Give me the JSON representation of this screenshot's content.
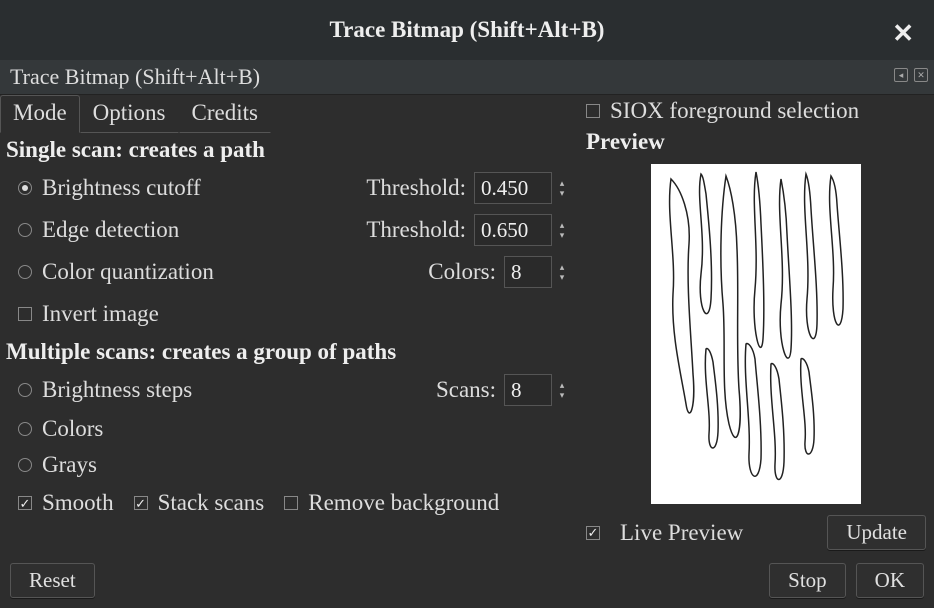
{
  "window": {
    "title": "Trace Bitmap (Shift+Alt+B)",
    "subtitle": "Trace Bitmap (Shift+Alt+B)"
  },
  "tabs": {
    "mode": "Mode",
    "options": "Options",
    "credits": "Credits"
  },
  "single_scan": {
    "title": "Single scan: creates a path",
    "brightness": "Brightness cutoff",
    "brightness_threshold_label": "Threshold:",
    "brightness_threshold_value": "0.450",
    "edge": "Edge detection",
    "edge_threshold_label": "Threshold:",
    "edge_threshold_value": "0.650",
    "color_quant": "Color quantization",
    "colors_label": "Colors:",
    "colors_value": "8",
    "invert": "Invert image"
  },
  "multi_scan": {
    "title": "Multiple scans: creates a group of paths",
    "brightness_steps": "Brightness steps",
    "scans_label": "Scans:",
    "scans_value": "8",
    "colors": "Colors",
    "grays": "Grays",
    "smooth": "Smooth",
    "stack": "Stack scans",
    "remove_bg": "Remove background"
  },
  "right": {
    "siox": "SIOX foreground selection",
    "preview_title": "Preview",
    "live_preview": "Live Preview",
    "update": "Update"
  },
  "buttons": {
    "reset": "Reset",
    "stop": "Stop",
    "ok": "OK"
  }
}
